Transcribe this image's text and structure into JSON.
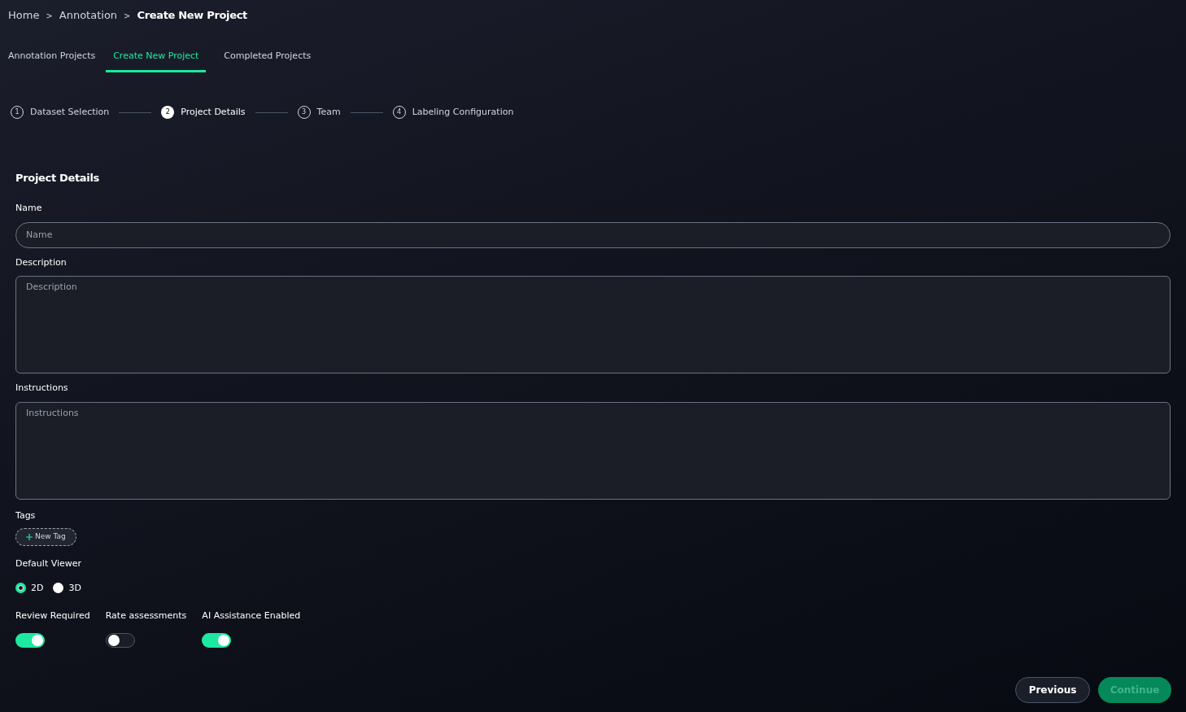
{
  "breadcrumb": [
    {
      "label": "Home",
      "current": false
    },
    {
      "label": "Annotation",
      "current": false
    },
    {
      "label": "Create New Project",
      "current": true
    }
  ],
  "breadcrumb_separator": ">",
  "tabs": [
    {
      "label": "Annotation Projects",
      "selected": false
    },
    {
      "label": "Create New Project",
      "selected": true
    },
    {
      "label": "Completed Projects",
      "selected": false
    }
  ],
  "steps": [
    {
      "number": "1",
      "label": "Dataset Selection",
      "selected": false
    },
    {
      "number": "2",
      "label": "Project Details",
      "selected": true
    },
    {
      "number": "3",
      "label": "Team",
      "selected": false
    },
    {
      "number": "4",
      "label": "Labeling Configuration",
      "selected": false
    }
  ],
  "section_title": "Project Details",
  "fields": [
    {
      "label": "Name",
      "placeholder": "Name",
      "kind": "input"
    },
    {
      "label": "Description",
      "placeholder": "Description",
      "kind": "textarea"
    },
    {
      "label": "Instructions",
      "placeholder": "Instructions",
      "kind": "textarea"
    }
  ],
  "tags": {
    "label": "Tags",
    "button": "New Tag"
  },
  "default_viewer": {
    "label": "Default Viewer",
    "options": [
      {
        "label": "2D",
        "selected": true
      },
      {
        "label": "3D",
        "selected": false
      }
    ]
  },
  "toggles": [
    {
      "label": "Review Required",
      "on": true
    },
    {
      "label": "Rate assessments",
      "on": false
    },
    {
      "label": "AI Assistance Enabled",
      "on": true
    }
  ],
  "buttons": {
    "previous": {
      "label": "Previous"
    },
    "continue": {
      "label": "Continue",
      "disabled": true
    }
  }
}
